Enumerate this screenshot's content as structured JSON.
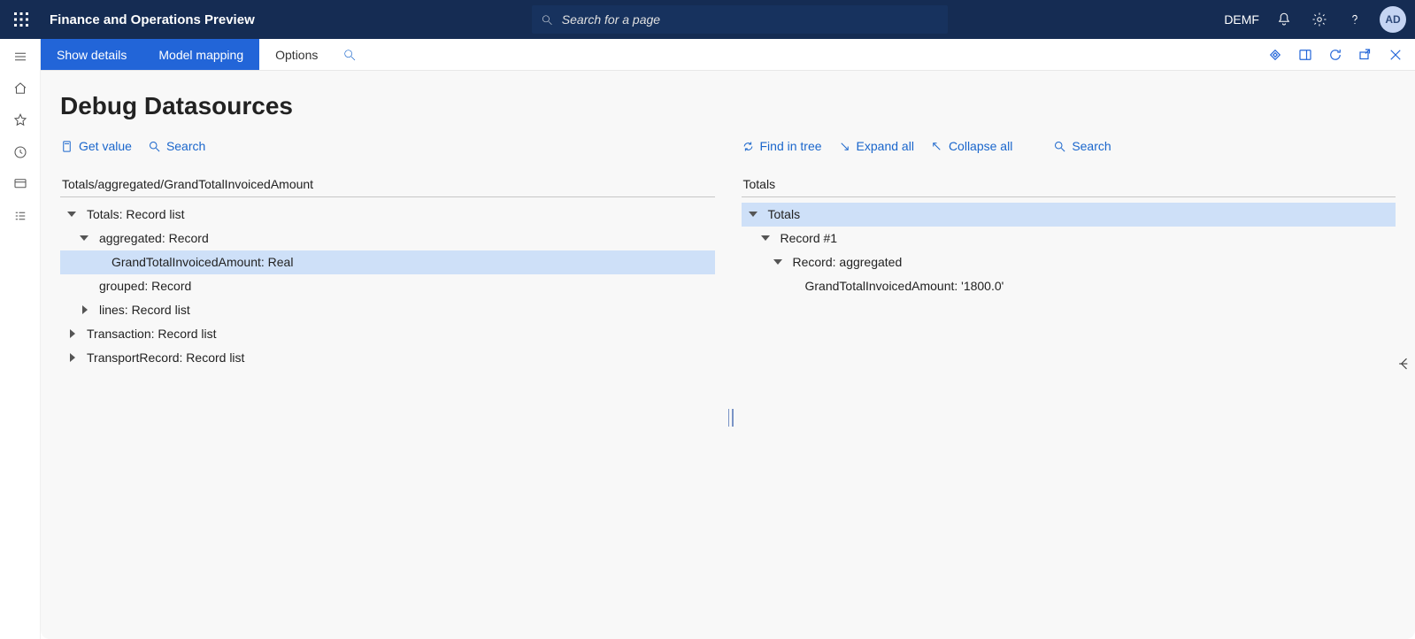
{
  "topbar": {
    "app_title": "Finance and Operations Preview",
    "search_placeholder": "Search for a page",
    "company": "DEMF",
    "avatar": "AD"
  },
  "actionbar": {
    "show_details": "Show details",
    "model_mapping": "Model mapping",
    "options": "Options"
  },
  "page": {
    "title": "Debug Datasources"
  },
  "left": {
    "toolbar": {
      "get_value": "Get value",
      "search": "Search"
    },
    "breadcrumb": "Totals/aggregated/GrandTotalInvoicedAmount",
    "tree": [
      {
        "label": "Totals: Record list",
        "indent": 0,
        "caret": "open",
        "selected": false
      },
      {
        "label": "aggregated: Record",
        "indent": 1,
        "caret": "open",
        "selected": false
      },
      {
        "label": "GrandTotalInvoicedAmount: Real",
        "indent": 2,
        "caret": "none",
        "selected": true
      },
      {
        "label": "grouped: Record",
        "indent": 1,
        "caret": "none",
        "selected": false
      },
      {
        "label": "lines: Record list",
        "indent": 1,
        "caret": "closed",
        "selected": false
      },
      {
        "label": "Transaction: Record list",
        "indent": 0,
        "caret": "closed",
        "selected": false
      },
      {
        "label": "TransportRecord: Record list",
        "indent": 0,
        "caret": "closed",
        "selected": false
      }
    ]
  },
  "right": {
    "toolbar": {
      "find_in_tree": "Find in tree",
      "expand_all": "Expand all",
      "collapse_all": "Collapse all",
      "search": "Search"
    },
    "breadcrumb": "Totals",
    "tree": [
      {
        "label": "Totals",
        "indent": 0,
        "caret": "open",
        "selected": true
      },
      {
        "label": "Record #1",
        "indent": 1,
        "caret": "open",
        "selected": false
      },
      {
        "label": "Record: aggregated",
        "indent": 2,
        "caret": "open",
        "selected": false
      },
      {
        "label": "GrandTotalInvoicedAmount: '1800.0'",
        "indent": 3,
        "caret": "none",
        "selected": false
      }
    ]
  }
}
